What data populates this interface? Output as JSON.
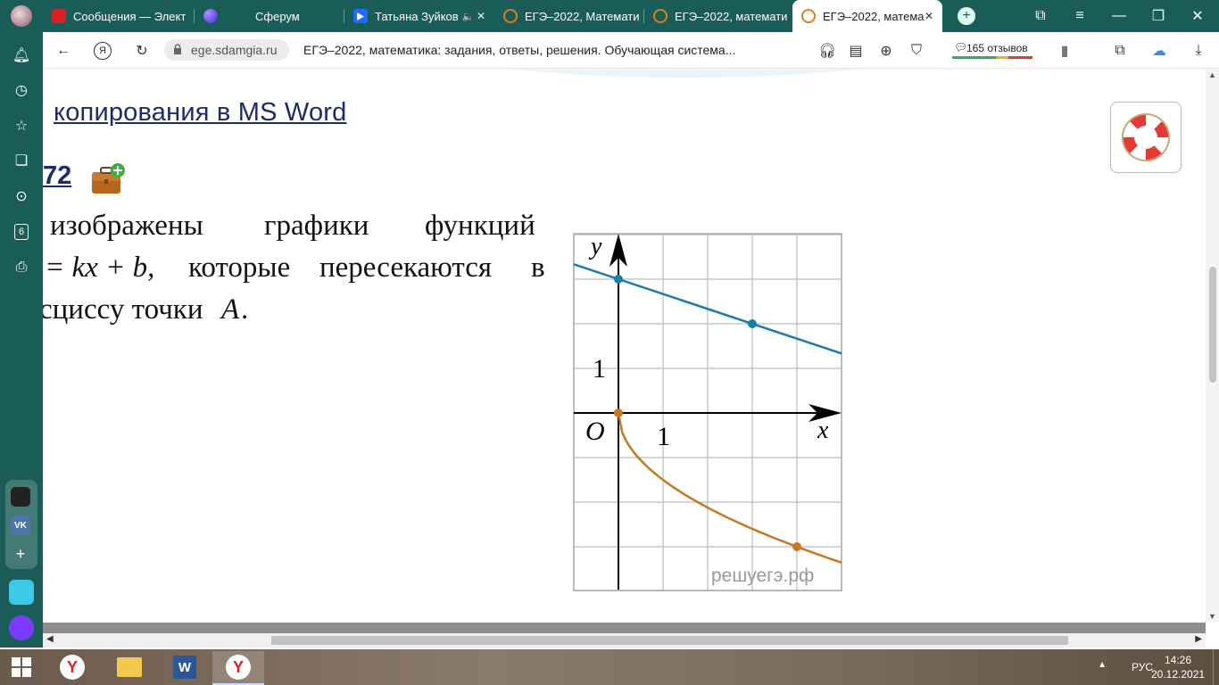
{
  "tabs": [
    {
      "title": "Сообщения — Элект",
      "icon": "mail-ru-icon",
      "color": "#d61f26"
    },
    {
      "title": "Сферум",
      "icon": "sferum-icon",
      "color": "#6c3bff"
    },
    {
      "title": "Татьяна Зуйков",
      "icon": "video-play-icon",
      "color": "#1e6cff"
    },
    {
      "title": "ЕГЭ–2022, Математи",
      "icon": "sdamgia-icon",
      "color": "#e07b1a"
    },
    {
      "title": "ЕГЭ–2022, математи",
      "icon": "sdamgia-icon",
      "color": "#e07b1a"
    },
    {
      "title": "ЕГЭ–2022, матема",
      "icon": "sdamgia-icon",
      "color": "#e07b1a",
      "active": true
    }
  ],
  "address": {
    "domain": "ege.sdamgia.ru",
    "title": "ЕГЭ–2022, математика: задания, ответы, решения. Обучающая система...",
    "reviews": "165 отзывов"
  },
  "sidebar": {
    "badge": "6"
  },
  "content": {
    "link_text": "копирования в MS Word",
    "problem_number": "72",
    "line1_words": [
      "изображены",
      "графики",
      "функций"
    ],
    "line2_eq": "= kx + b,",
    "line2_rest": [
      "которые",
      "пересекаются",
      "в"
    ],
    "line3_text": "сциссу точки",
    "line3_var": "A",
    "line3_end": "."
  },
  "graph": {
    "axis_x": "x",
    "axis_y": "y",
    "origin": "O",
    "tick_x": "1",
    "tick_y": "1",
    "watermark": "решуегэ.рф",
    "line_color": "#1a7fa0",
    "curve_color": "#c87820",
    "line_points": [
      [
        0,
        3
      ],
      [
        3,
        2
      ]
    ],
    "curve_points": [
      [
        0,
        0
      ],
      [
        4,
        -3
      ]
    ]
  },
  "taskbar": {
    "lang": "РУС",
    "time": "14:26",
    "date": "20.12.2021"
  }
}
